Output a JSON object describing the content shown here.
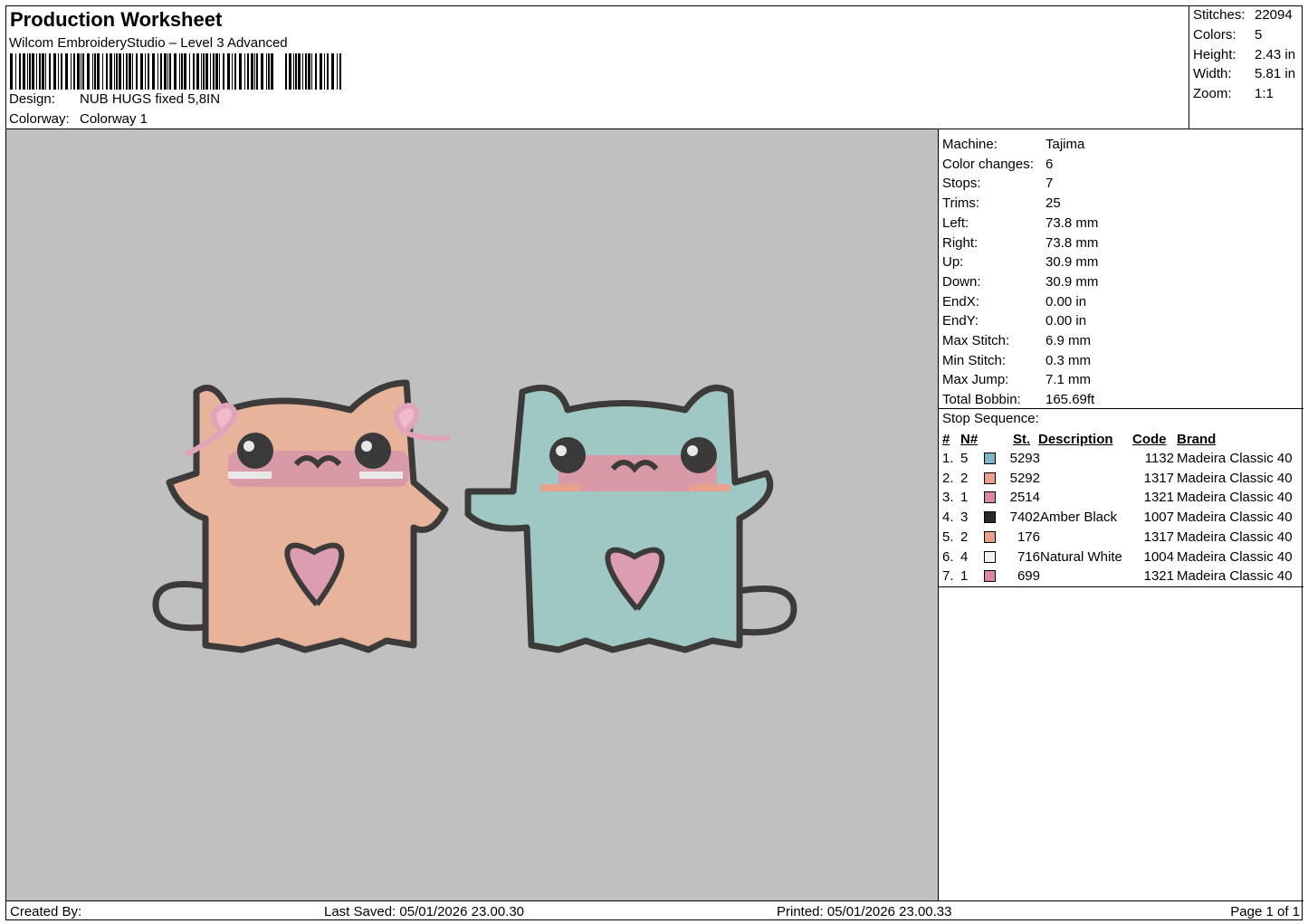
{
  "header": {
    "title": "Production Worksheet",
    "subtitle": "Wilcom EmbroideryStudio – Level 3 Advanced",
    "design_label": "Design:",
    "design_value": "NUB HUGS fixed 5,8IN",
    "colorway_label": "Colorway:",
    "colorway_value": "Colorway 1"
  },
  "stats": {
    "stitches_label": "Stitches:",
    "stitches_value": "22094",
    "colors_label": "Colors:",
    "colors_value": "5",
    "height_label": "Height:",
    "height_value": "2.43 in",
    "width_label": "Width:",
    "width_value": "5.81 in",
    "zoom_label": "Zoom:",
    "zoom_value": "1:1"
  },
  "machine_info": [
    {
      "label": "Machine:",
      "value": "Tajima"
    },
    {
      "label": "Color changes:",
      "value": "6"
    },
    {
      "label": "Stops:",
      "value": "7"
    },
    {
      "label": "Trims:",
      "value": "25"
    },
    {
      "label": "Left:",
      "value": "73.8 mm"
    },
    {
      "label": "Right:",
      "value": "73.8 mm"
    },
    {
      "label": "Up:",
      "value": "30.9 mm"
    },
    {
      "label": "Down:",
      "value": "30.9 mm"
    },
    {
      "label": "EndX:",
      "value": "0.00 in"
    },
    {
      "label": "EndY:",
      "value": "0.00 in"
    },
    {
      "label": "Max Stitch:",
      "value": "6.9 mm"
    },
    {
      "label": "Min Stitch:",
      "value": "0.3 mm"
    },
    {
      "label": "Max Jump:",
      "value": "7.1 mm"
    },
    {
      "label": "Total Bobbin:",
      "value": "165.69ft"
    }
  ],
  "stop_sequence": {
    "title": "Stop Sequence:",
    "headers": {
      "num": "#",
      "n": "N#",
      "st": "St.",
      "desc": "Description",
      "code": "Code",
      "brand": "Brand"
    },
    "rows": [
      {
        "num": "1.",
        "n": "5",
        "color": "#7fb6c7",
        "st": "5293",
        "desc": "",
        "code": "1132",
        "brand": "Madeira Classic 40"
      },
      {
        "num": "2.",
        "n": "2",
        "color": "#eba08e",
        "st": "5292",
        "desc": "",
        "code": "1317",
        "brand": "Madeira Classic 40"
      },
      {
        "num": "3.",
        "n": "1",
        "color": "#dc86a8",
        "st": "2514",
        "desc": "",
        "code": "1321",
        "brand": "Madeira Classic 40"
      },
      {
        "num": "4.",
        "n": "3",
        "color": "#2b2b2b",
        "st": "7402",
        "desc": "Amber Black",
        "code": "1007",
        "brand": "Madeira Classic 40"
      },
      {
        "num": "5.",
        "n": "2",
        "color": "#eba08e",
        "st": "176",
        "desc": "",
        "code": "1317",
        "brand": "Madeira Classic 40"
      },
      {
        "num": "6.",
        "n": "4",
        "color": "#f2f2f2",
        "st": "716",
        "desc": "Natural White",
        "code": "1004",
        "brand": "Madeira Classic 40"
      },
      {
        "num": "7.",
        "n": "1",
        "color": "#dc86a8",
        "st": "699",
        "desc": "",
        "code": "1321",
        "brand": "Madeira Classic 40"
      }
    ]
  },
  "footer": {
    "created_by": "Created By:",
    "last_saved": "Last Saved: 05/01/2026 23.00.30",
    "printed": "Printed: 05/01/2026 23.00.33",
    "page": "Page 1 of 1"
  }
}
